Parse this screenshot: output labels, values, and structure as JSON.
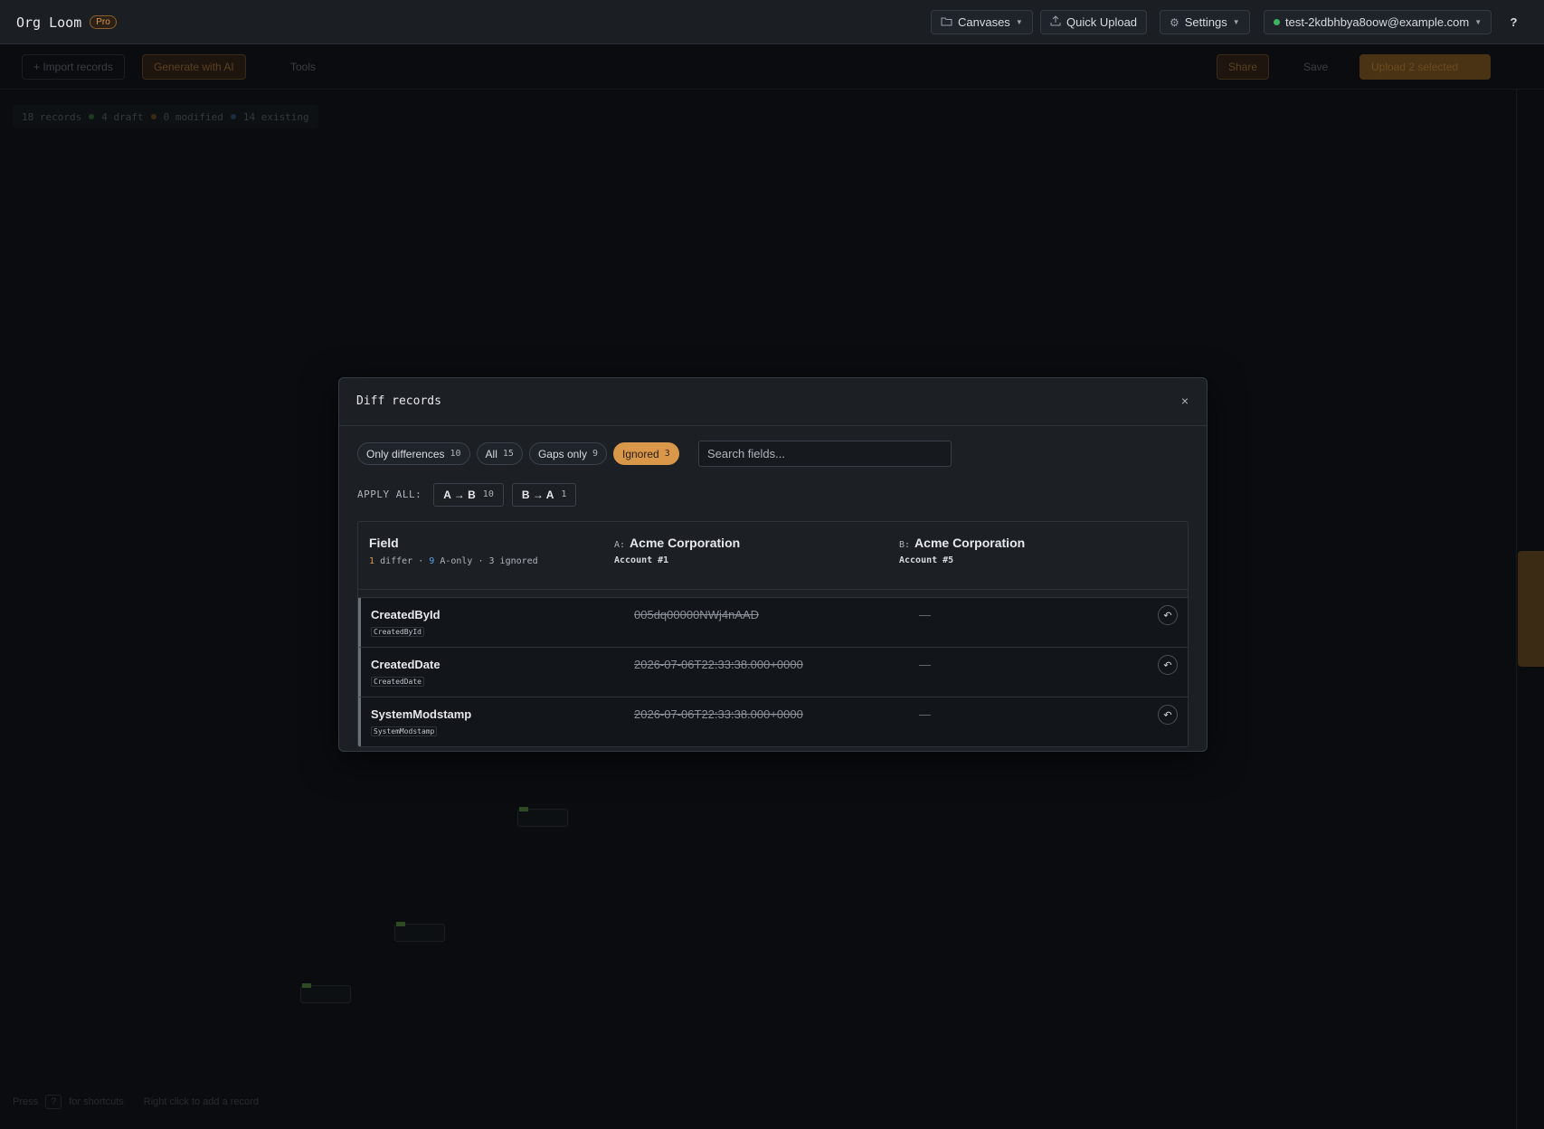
{
  "app": {
    "name": "Org Loom",
    "plan_badge": "Pro"
  },
  "topbar": {
    "canvases_label": "Canvases",
    "quick_upload_label": "Quick Upload",
    "settings_label": "Settings",
    "user_email": "test-2kdbhbya8oow@example.com",
    "help_label": "?"
  },
  "toolbar": {
    "import_label": "+ Import records",
    "generate_label": "Generate with AI",
    "tools_label": "Tools",
    "share_label": "Share",
    "save_label": "Save",
    "upload_label": "Upload 2 selected"
  },
  "stats": {
    "records": "18 records",
    "draft": "4 draft",
    "modified": "0 modified",
    "existing": "14 existing"
  },
  "footer": {
    "press": "Press",
    "key": "?",
    "shortcuts": "for shortcuts",
    "right_click": "Right click to add a record"
  },
  "modal": {
    "title": "Diff records",
    "close_label": "×",
    "filters": [
      {
        "label": "Only differences",
        "count": "10",
        "active": false
      },
      {
        "label": "All",
        "count": "15",
        "active": false
      },
      {
        "label": "Gaps only",
        "count": "9",
        "active": false
      },
      {
        "label": "Ignored",
        "count": "3",
        "active": true
      }
    ],
    "search_placeholder": "Search fields...",
    "apply_all_label": "APPLY ALL:",
    "apply_a_to_b": {
      "label": "A → B",
      "count": "10"
    },
    "apply_b_to_a": {
      "label": "B → A",
      "count": "1"
    },
    "header": {
      "field_title": "Field",
      "summary": {
        "differ_count": "1",
        "differ_text": "differ ·",
        "aonly_count": "9",
        "aonly_text": "A-only · 3 ignored"
      },
      "record_a": {
        "prefix": "A:",
        "name": "Acme Corporation",
        "sub": "Account #1"
      },
      "record_b": {
        "prefix": "B:",
        "name": "Acme Corporation",
        "sub": "Account #5"
      }
    },
    "rows": [
      {
        "label": "CreatedById",
        "api": "CreatedById",
        "a": "005dq00000NWj4nAAD",
        "b": "—"
      },
      {
        "label": "CreatedDate",
        "api": "CreatedDate",
        "a": "2026-07-06T22:33:38.000+0000",
        "b": "—"
      },
      {
        "label": "SystemModstamp",
        "api": "SystemModstamp",
        "a": "2026-07-06T22:33:38.000+0000",
        "b": "—"
      }
    ],
    "restore_icon": "undo-icon"
  },
  "colors": {
    "accent": "#d9974a",
    "background": "#0a0c0f",
    "modal_bg": "#1c2025",
    "status_green": "#3fb35f",
    "aonly_blue": "#5aa0e6"
  }
}
